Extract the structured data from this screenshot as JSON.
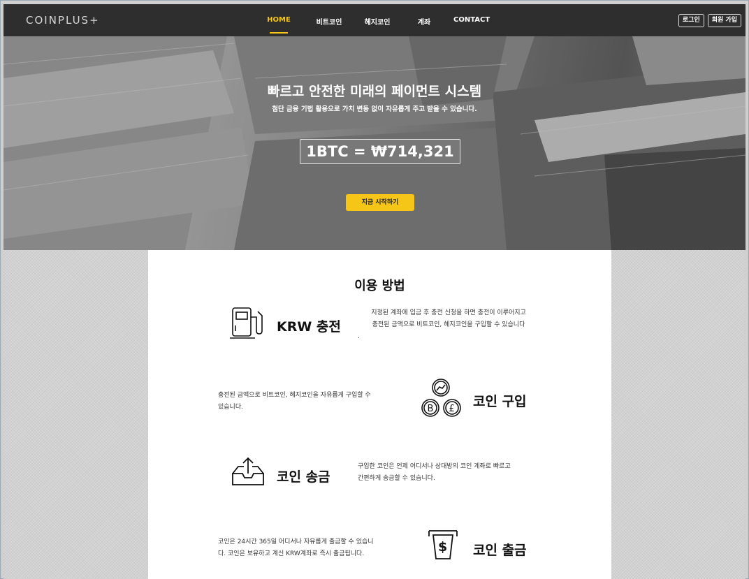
{
  "nav": {
    "logo": "COINPLUS+",
    "items": [
      {
        "label": "HOME",
        "active": true
      },
      {
        "label": "비트코인",
        "active": false
      },
      {
        "label": "헤지코인",
        "active": false
      },
      {
        "label": "계좌",
        "active": false
      },
      {
        "label": "CONTACT",
        "active": false
      }
    ],
    "login_label": "로그인",
    "signup_label": "회원 가입"
  },
  "hero": {
    "title": "빠르고 안전한 미래의 페이먼트 시스템",
    "subtitle": "첨단 금융 기법 활용으로 가치 변동 없이 자유롭게 주고 받을 수 있습니다.",
    "price": "1BTC = ₩714,321",
    "cta_label": "지금 시작하기"
  },
  "usage": {
    "title": "이용 방법",
    "features": [
      {
        "title": "KRW 충전",
        "icon": "fuel-pump-icon",
        "desc_line1": "지정된 계좌에 입금 후 충전 신청을 하면 충전이 이루어지고",
        "desc_line2": "충전된 금액으로 비트코인, 헤지코인을 구입할 수 있습니다",
        "desc_line3": "."
      },
      {
        "title": "코인 구입",
        "icon": "coins-icon",
        "desc_line1": "충전된 금액으로 비트코인, 헤지코인을 자유롭게 구입할 수",
        "desc_line2": "있습니다."
      },
      {
        "title": "코인 송금",
        "icon": "upload-tray-icon",
        "desc_line1": "구입한 코인은 언제 어디서나 상대방의 코인 계좌로 빠르고",
        "desc_line2": "간편하게 송금할 수 있습니다."
      },
      {
        "title": "코인 출금",
        "icon": "atm-cash-icon",
        "desc_line1": "코인은 24시간 365일 어디서나 자유롭게 출금할 수 있습니",
        "desc_line2": "다. 코인은 보유하고 계신 KRW계좌로 즉시 출금됩니다."
      }
    ]
  },
  "colors": {
    "accent": "#f5c518",
    "nav_bg": "#2e2e2e"
  }
}
